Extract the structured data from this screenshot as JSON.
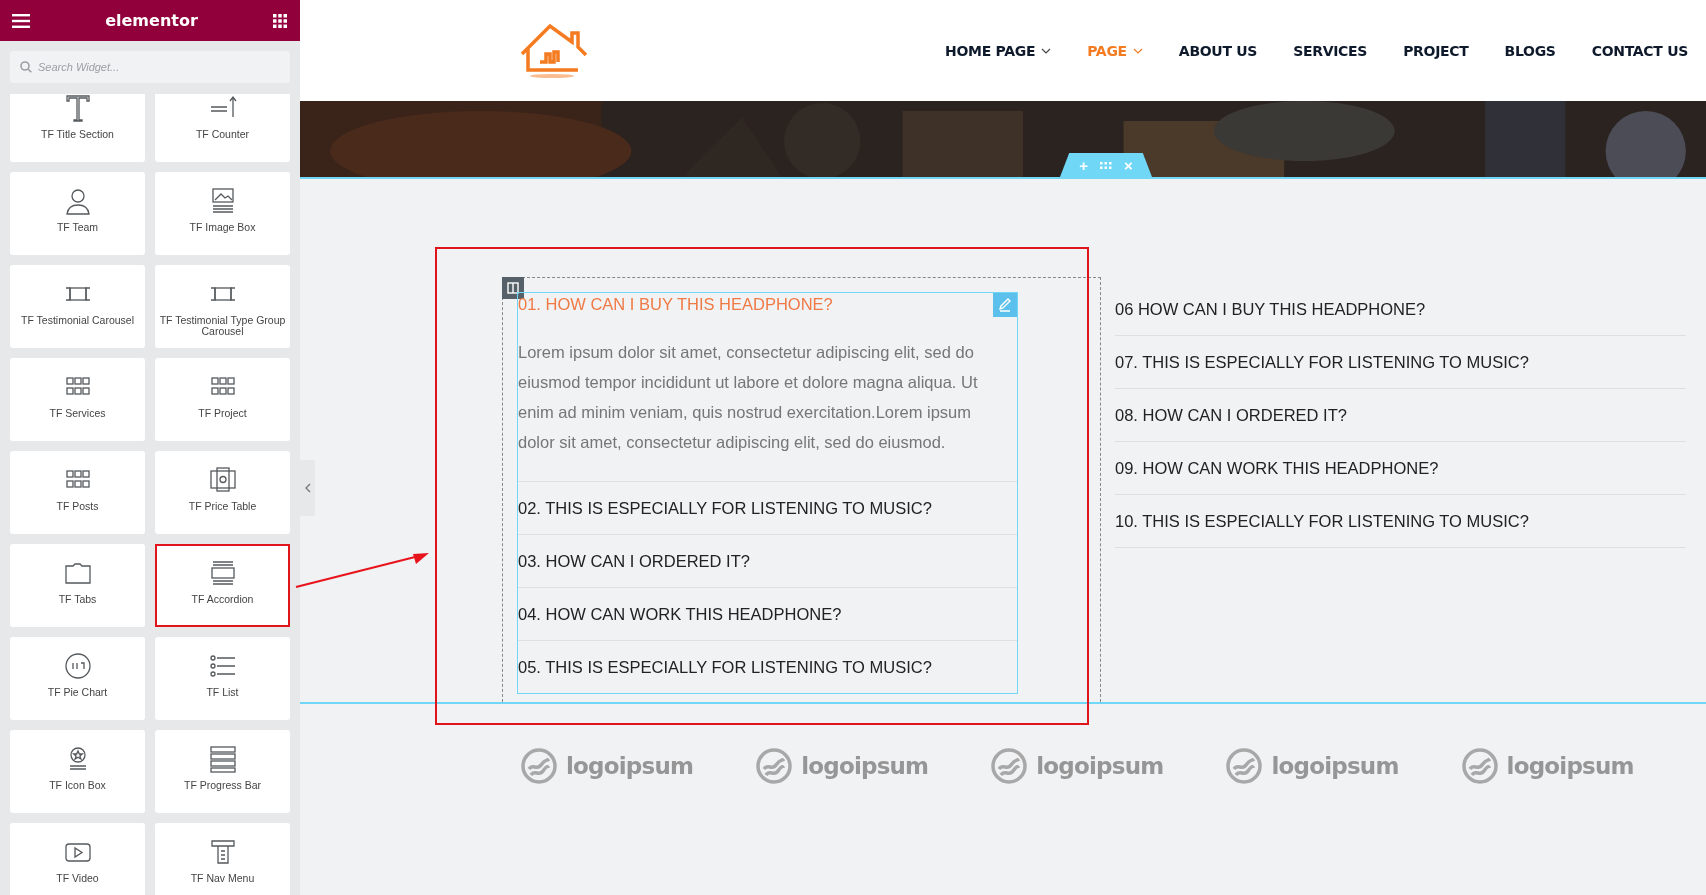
{
  "editor_panel": {
    "brand": "elementor",
    "search": {
      "placeholder": "Search Widget..."
    },
    "widgets": [
      {
        "label": "TF Title Section",
        "highlighted": false
      },
      {
        "label": "TF Counter",
        "highlighted": false
      },
      {
        "label": "TF Team",
        "highlighted": false
      },
      {
        "label": "TF Image Box",
        "highlighted": false
      },
      {
        "label": "TF Testimonial Carousel",
        "highlighted": false
      },
      {
        "label": "TF Testimonial Type Group Carousel",
        "highlighted": false
      },
      {
        "label": "TF Services",
        "highlighted": false
      },
      {
        "label": "TF Project",
        "highlighted": false
      },
      {
        "label": "TF Posts",
        "highlighted": false
      },
      {
        "label": "TF Price Table",
        "highlighted": false
      },
      {
        "label": "TF Tabs",
        "highlighted": false
      },
      {
        "label": "TF Accordion",
        "highlighted": true
      },
      {
        "label": "TF Pie Chart",
        "highlighted": false
      },
      {
        "label": "TF List",
        "highlighted": false
      },
      {
        "label": "TF Icon Box",
        "highlighted": false
      },
      {
        "label": "TF Progress Bar",
        "highlighted": false
      },
      {
        "label": "TF Video",
        "highlighted": false
      },
      {
        "label": "TF Nav Menu",
        "highlighted": false
      }
    ]
  },
  "nav": [
    {
      "label": "HOME PAGE",
      "selected": false,
      "dropdown": true
    },
    {
      "label": "PAGE",
      "selected": true,
      "dropdown": true
    },
    {
      "label": "ABOUT US",
      "selected": false,
      "dropdown": false
    },
    {
      "label": "SERVICES",
      "selected": false,
      "dropdown": false
    },
    {
      "label": "PROJECT",
      "selected": false,
      "dropdown": false
    },
    {
      "label": "BLOGS",
      "selected": false,
      "dropdown": false
    },
    {
      "label": "CONTACT US",
      "selected": false,
      "dropdown": false
    }
  ],
  "section_handle": {
    "add": "+",
    "close": "×"
  },
  "accordion_left": [
    {
      "title": "01. HOW CAN I BUY THIS HEADPHONE?",
      "expanded": true,
      "body": "Lorem ipsum dolor sit amet, consectetur adipiscing elit, sed do eiusmod tempor incididunt ut labore et dolore magna aliqua. Ut enim ad minim veniam, quis nostrud exercitation.Lorem ipsum dolor sit amet, consectetur adipiscing elit, sed do eiusmod."
    },
    {
      "title": "02. THIS IS ESPECIALLY FOR LISTENING TO MUSIC?",
      "expanded": false
    },
    {
      "title": "03. HOW CAN I ORDERED IT?",
      "expanded": false
    },
    {
      "title": "04. HOW CAN WORK THIS HEADPHONE?",
      "expanded": false
    },
    {
      "title": "05. THIS IS ESPECIALLY FOR LISTENING TO MUSIC?",
      "expanded": false
    }
  ],
  "accordion_right": [
    {
      "title": "06 HOW CAN I BUY THIS HEADPHONE?",
      "expanded": false
    },
    {
      "title": "07. THIS IS ESPECIALLY FOR LISTENING TO MUSIC?",
      "expanded": false
    },
    {
      "title": "08. HOW CAN I ORDERED IT?",
      "expanded": false
    },
    {
      "title": "09. HOW CAN WORK THIS HEADPHONE?",
      "expanded": false
    },
    {
      "title": "10. THIS IS ESPECIALLY FOR LISTENING TO MUSIC?",
      "expanded": false
    }
  ],
  "partner_logos": [
    "logoipsum",
    "logoipsum",
    "logoipsum",
    "logoipsum",
    "logoipsum"
  ]
}
